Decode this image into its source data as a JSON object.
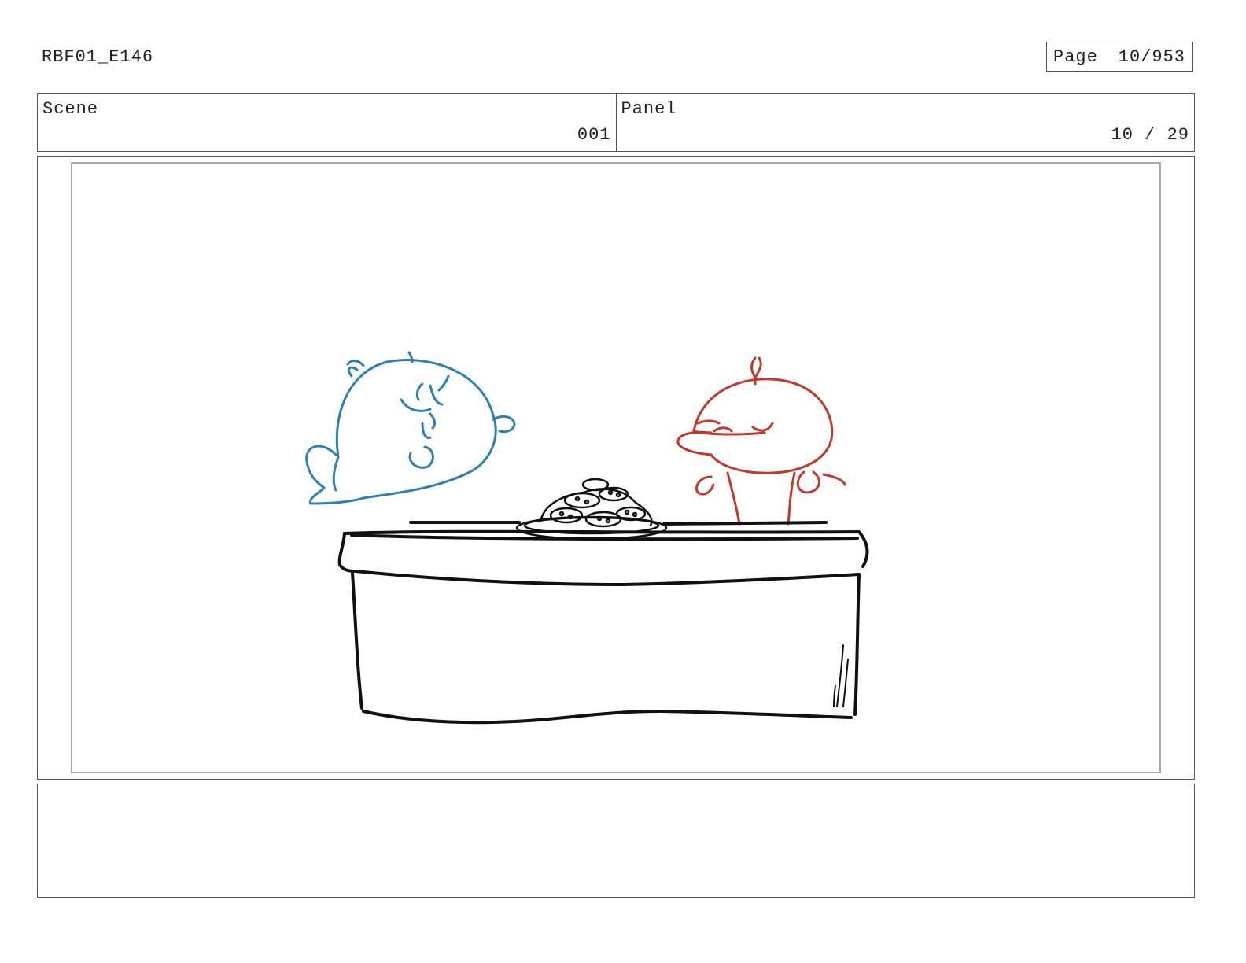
{
  "header": {
    "project_id": "RBF01_E146",
    "page_label": "Page",
    "page_value": "10/953"
  },
  "scene": {
    "label": "Scene",
    "value": "001"
  },
  "panel": {
    "label": "Panel",
    "value": "10 / 29"
  },
  "drawing": {
    "blue_character_color": "#2f7fb5",
    "red_character_color": "#c0392b",
    "ink_color": "#111111"
  },
  "notes": {
    "text": ""
  }
}
